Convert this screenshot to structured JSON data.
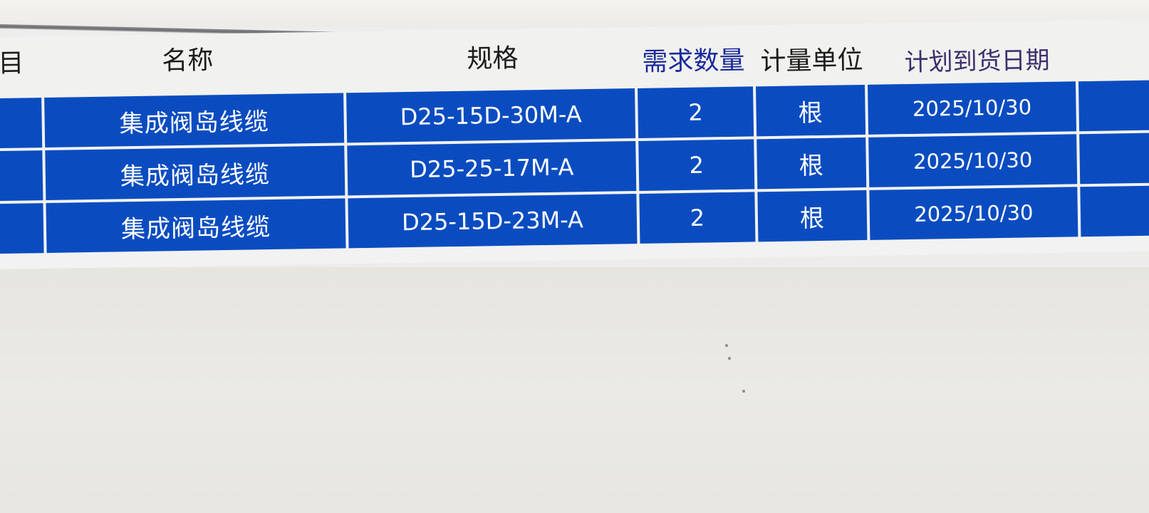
{
  "table": {
    "headers": {
      "col0": "目",
      "name": "名称",
      "spec": "规格",
      "qty": "需求数量",
      "unit": "计量单位",
      "date": "计划到货日期"
    },
    "rows": [
      {
        "name": "集成阀岛线缆",
        "spec": "D25-15D-30M-A",
        "qty": "2",
        "unit": "根",
        "date": "2025/10/30"
      },
      {
        "name": "集成阀岛线缆",
        "spec": "D25-25-17M-A",
        "qty": "2",
        "unit": "根",
        "date": "2025/10/30"
      },
      {
        "name": "集成阀岛线缆",
        "spec": "D25-15D-23M-A",
        "qty": "2",
        "unit": "根",
        "date": "2025/10/30"
      }
    ]
  },
  "colors": {
    "selected_row_bg": "#0a4cc0",
    "header_bg": "#f1f1ef",
    "qty_header_color": "#1a2a9a",
    "date_header_color": "#3d2f6e"
  }
}
